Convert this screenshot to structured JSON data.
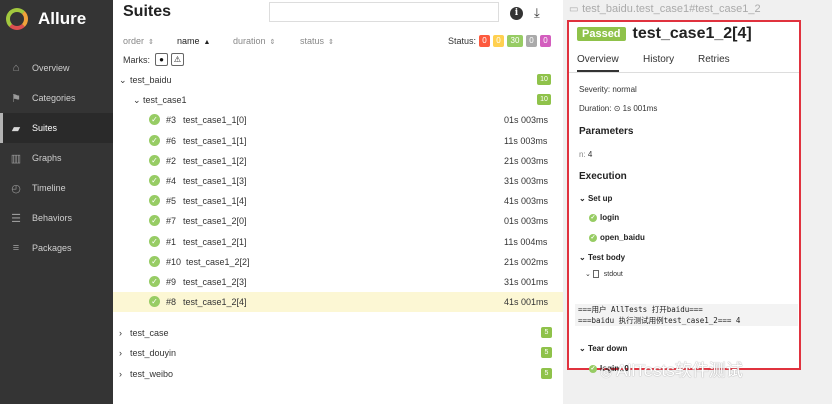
{
  "app": {
    "name": "Allure"
  },
  "sidebar": {
    "items": [
      {
        "label": "Overview",
        "icon": "home-icon"
      },
      {
        "label": "Categories",
        "icon": "flag-icon"
      },
      {
        "label": "Suites",
        "icon": "briefcase-icon"
      },
      {
        "label": "Graphs",
        "icon": "bar-chart-icon"
      },
      {
        "label": "Timeline",
        "icon": "clock-icon"
      },
      {
        "label": "Behaviors",
        "icon": "list-icon"
      },
      {
        "label": "Packages",
        "icon": "packages-icon"
      }
    ],
    "active": "Suites"
  },
  "suites": {
    "title": "Suites",
    "search_placeholder": "",
    "sort": {
      "order": "order",
      "name": "name",
      "duration": "duration",
      "status": "status"
    },
    "status_label": "Status:",
    "status_counts": [
      {
        "value": "0",
        "color": "#fd5a3e"
      },
      {
        "value": "0",
        "color": "#ffd050"
      },
      {
        "value": "30",
        "color": "#97cc64"
      },
      {
        "value": "0",
        "color": "#aaaaaa"
      },
      {
        "value": "0",
        "color": "#d35ebe"
      }
    ],
    "marks_label": "Marks:",
    "tree": {
      "test_baidu": {
        "label": "test_baidu",
        "count": "10"
      },
      "test_case1": {
        "label": "test_case1",
        "count": "10"
      },
      "tests": [
        {
          "order": "#3",
          "name": "test_case1_1[0]",
          "duration": "01s 003ms"
        },
        {
          "order": "#6",
          "name": "test_case1_1[1]",
          "duration": "11s 003ms"
        },
        {
          "order": "#2",
          "name": "test_case1_1[2]",
          "duration": "21s 003ms"
        },
        {
          "order": "#4",
          "name": "test_case1_1[3]",
          "duration": "31s 003ms"
        },
        {
          "order": "#5",
          "name": "test_case1_1[4]",
          "duration": "41s 003ms"
        },
        {
          "order": "#7",
          "name": "test_case1_2[0]",
          "duration": "01s 003ms"
        },
        {
          "order": "#1",
          "name": "test_case1_2[1]",
          "duration": "11s 004ms"
        },
        {
          "order": "#10",
          "name": "test_case1_2[2]",
          "duration": "21s 002ms"
        },
        {
          "order": "#9",
          "name": "test_case1_2[3]",
          "duration": "31s 001ms"
        },
        {
          "order": "#8",
          "name": "test_case1_2[4]",
          "duration": "41s 001ms"
        }
      ],
      "other_groups": [
        {
          "label": "test_case",
          "count": "5"
        },
        {
          "label": "test_douyin",
          "count": "5"
        },
        {
          "label": "test_weibo",
          "count": "5"
        }
      ]
    }
  },
  "detail": {
    "breadcrumb": "test_baidu.test_case1#test_case1_2",
    "status": "Passed",
    "title": "test_case1_2[4]",
    "tabs": [
      "Overview",
      "History",
      "Retries"
    ],
    "severity": "Severity: normal",
    "duration": "Duration:",
    "duration_value": "1s 001ms",
    "parameters_heading": "Parameters",
    "param_name": "n:",
    "param_value": "4",
    "execution_heading": "Execution",
    "setup_heading": "Set up",
    "setup_steps": [
      "login",
      "open_baidu"
    ],
    "body_heading": "Test body",
    "attachment": "stdout",
    "stdout_lines": [
      "===用户 AllTests 打开baidu===",
      "===baidu 执行测试用例test_case1_2=== 4"
    ],
    "teardown_heading": "Tear down",
    "teardown_steps": [
      "login::0"
    ]
  },
  "watermark": "AllTests软件测试"
}
